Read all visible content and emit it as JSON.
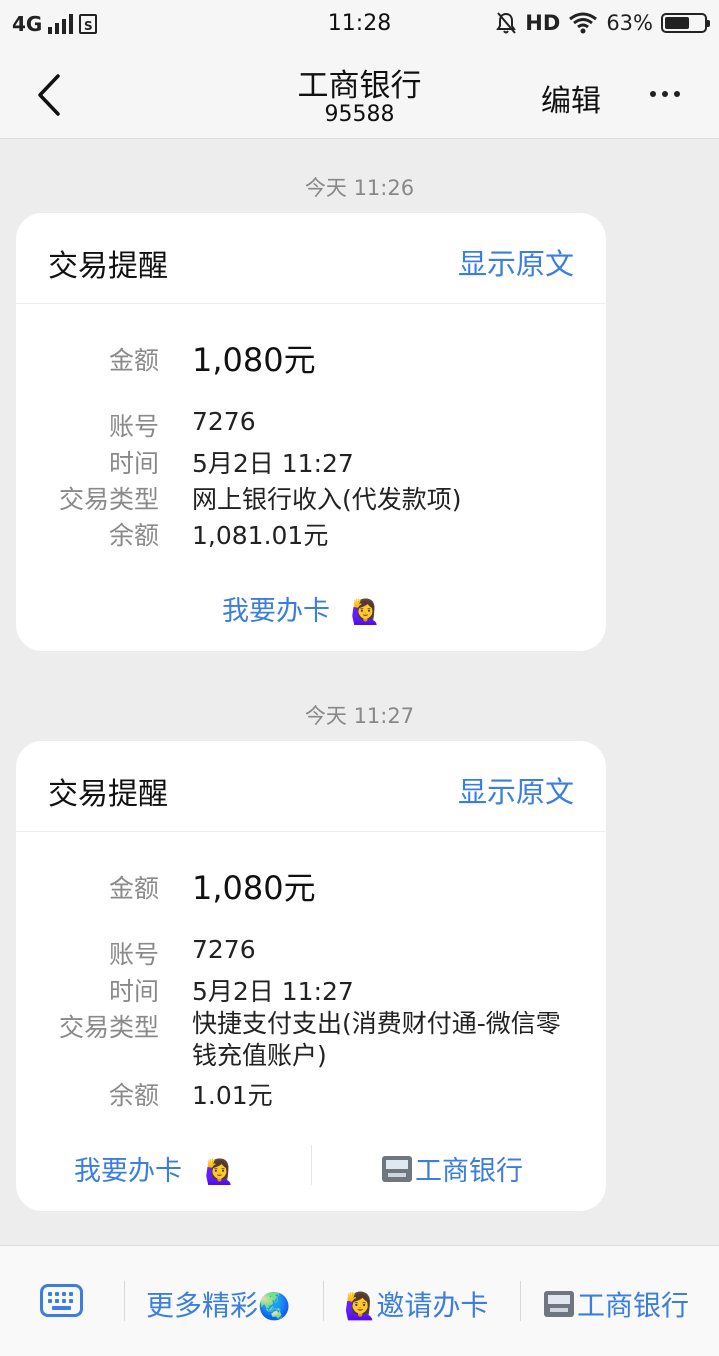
{
  "status_bar": {
    "network": "4G",
    "time": "11:28",
    "hd": "HD",
    "battery_percent": "63%",
    "battery_level": 0.63
  },
  "nav": {
    "title": "工商银行",
    "subtitle": "95588",
    "edit_label": "编辑"
  },
  "messages": [
    {
      "timestamp": "今天 11:26",
      "card_title": "交易提醒",
      "show_original": "显示原文",
      "amount_label": "金额",
      "amount": "1,080元",
      "account_label": "账号",
      "account": "7276",
      "time_label": "时间",
      "time": "5月2日 11:27",
      "type_label": "交易类型",
      "type": "网上银行收入(代发款项)",
      "balance_label": "余额",
      "balance": "1,081.01元",
      "action_1": "我要办卡",
      "action_1_emoji": "🙋‍♀️"
    },
    {
      "timestamp": "今天 11:27",
      "card_title": "交易提醒",
      "show_original": "显示原文",
      "amount_label": "金额",
      "amount": "1,080元",
      "account_label": "账号",
      "account": "7276",
      "time_label": "时间",
      "time": "5月2日 11:27",
      "type_label": "交易类型",
      "type": "快捷支付支出(消费财付通-微信零钱充值账户)",
      "balance_label": "余额",
      "balance": "1.01元",
      "action_1": "我要办卡",
      "action_1_emoji": "🙋‍♀️",
      "action_2": "工商银行"
    }
  ],
  "toolbar": {
    "item_1": "更多精彩",
    "item_1_emoji": "🌏",
    "item_2_emoji": "🙋‍♀️",
    "item_2": "邀请办卡",
    "item_3": "工商银行"
  }
}
